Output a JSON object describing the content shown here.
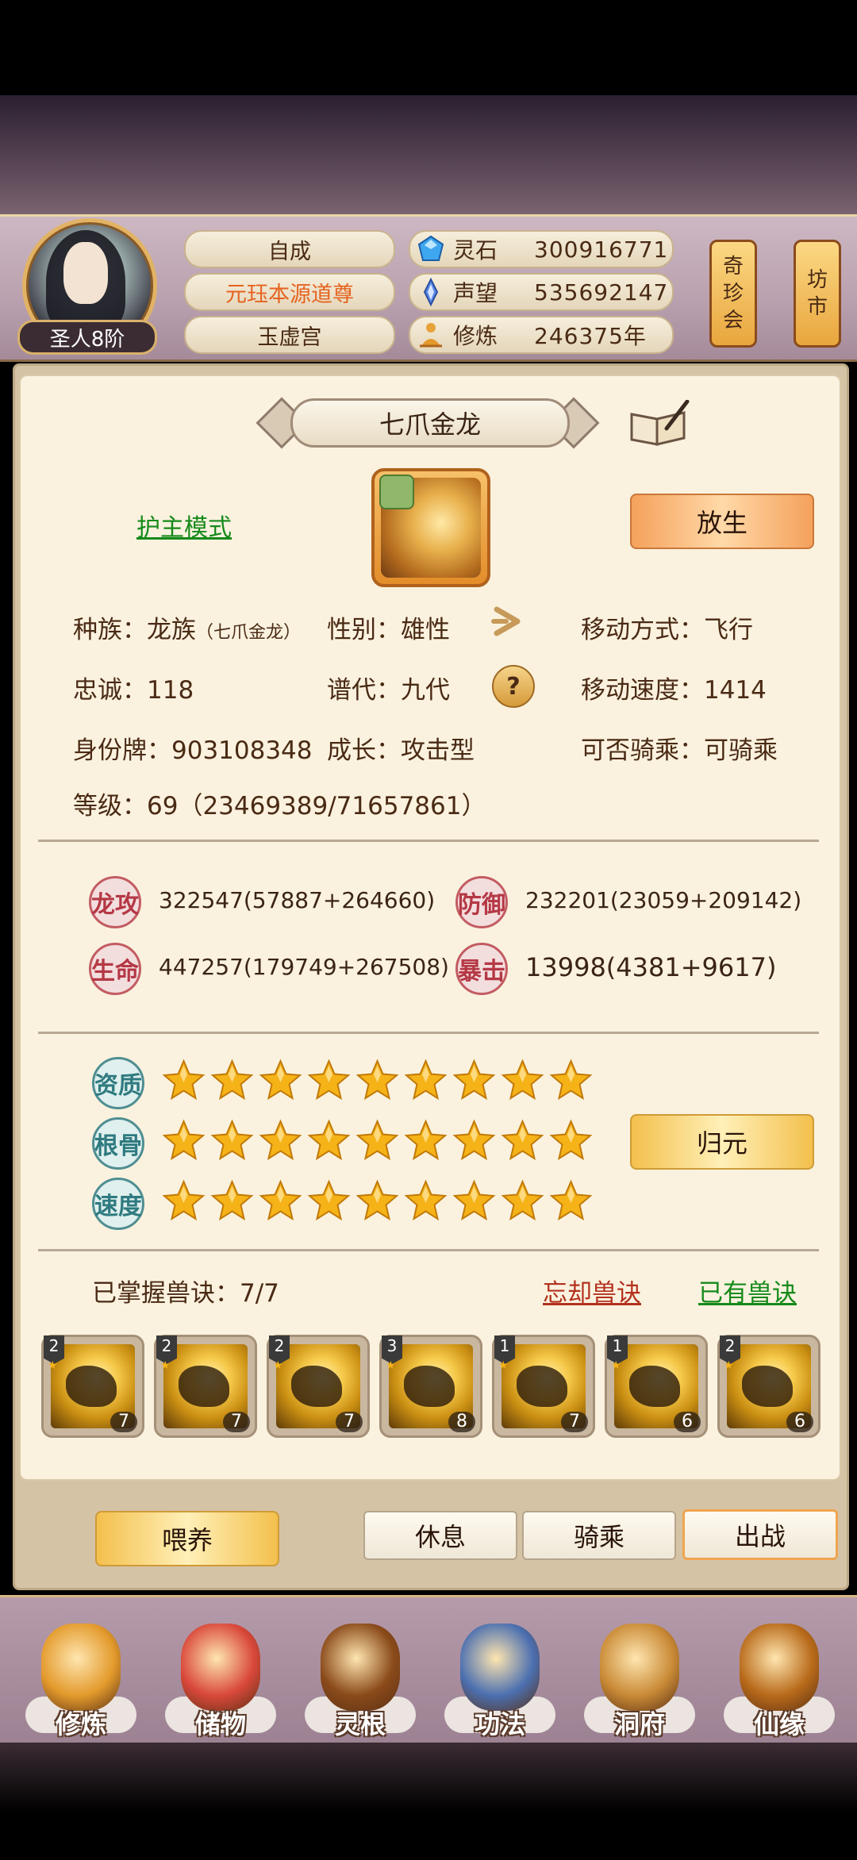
{
  "header": {
    "rank": "圣人8阶",
    "info_pills": [
      "自成",
      "元珏本源道尊",
      "玉虚宫"
    ],
    "resources": [
      {
        "icon": "spirit-stone-icon",
        "label": "灵石",
        "value": "300916771"
      },
      {
        "icon": "reputation-icon",
        "label": "声望",
        "value": "535692147"
      },
      {
        "icon": "cultivation-icon",
        "label": "修炼",
        "value": "246375年"
      }
    ],
    "banners": [
      {
        "label": [
          "奇",
          "珍",
          "会"
        ]
      },
      {
        "label": [
          "坊",
          "市"
        ]
      }
    ]
  },
  "pet": {
    "name": "七爪金龙",
    "guard_mode": "护主模式",
    "release": "放生",
    "info": {
      "race_label": "种族：",
      "race": "龙族",
      "race_sub": "（七爪金龙）",
      "gender_label": "性别：",
      "gender": "雄性",
      "move_label": "移动方式：",
      "move": "飞行",
      "loyalty_label": "忠诚：",
      "loyalty": "118",
      "gen_label": "谱代：",
      "gen": "九代",
      "speed_label": "移动速度：",
      "speed": "1414",
      "id_label": "身份牌：",
      "id": "903108348",
      "growth_label": "成长：",
      "growth": "攻击型",
      "ride_label": "可否骑乘：",
      "ride": "可骑乘",
      "level_text": "等级：69（23469389/71657861）"
    },
    "stats": [
      {
        "label": "龙攻",
        "value": "322547(57887+264660)"
      },
      {
        "label": "防御",
        "value": "232201(23059+209142)"
      },
      {
        "label": "生命",
        "value": "447257(179749+267508)"
      },
      {
        "label": "暴击",
        "value": "13998(4381+9617)"
      }
    ],
    "aptitudes": [
      {
        "label": "资质",
        "stars": 9
      },
      {
        "label": "根骨",
        "stars": 9
      },
      {
        "label": "速度",
        "stars": 9
      }
    ],
    "guiyuan": "归元",
    "skills_text": "已掌握兽诀：7/7",
    "forget_skill": "忘却兽诀",
    "owned_skills": "已有兽诀",
    "skills": [
      {
        "tier": "2",
        "level": "7"
      },
      {
        "tier": "2",
        "level": "7"
      },
      {
        "tier": "2",
        "level": "7"
      },
      {
        "tier": "3",
        "level": "8"
      },
      {
        "tier": "1",
        "level": "7"
      },
      {
        "tier": "1",
        "level": "6"
      },
      {
        "tier": "2",
        "level": "6"
      }
    ]
  },
  "actions": {
    "feed": "喂养",
    "rest": "休息",
    "ride": "骑乘",
    "battle": "出战"
  },
  "bottom_nav": [
    {
      "label": "修炼",
      "icon": "meditating-monk-icon"
    },
    {
      "label": "储物",
      "icon": "storage-bag-icon"
    },
    {
      "label": "灵根",
      "icon": "spirit-root-icon"
    },
    {
      "label": "功法",
      "icon": "scripture-book-icon"
    },
    {
      "label": "洞府",
      "icon": "cave-palace-icon"
    },
    {
      "label": "仙缘",
      "icon": "gourd-icon"
    }
  ],
  "colors": {
    "green_link": "#168a1a",
    "red_link": "#b2321f",
    "star": "#f5b318"
  }
}
